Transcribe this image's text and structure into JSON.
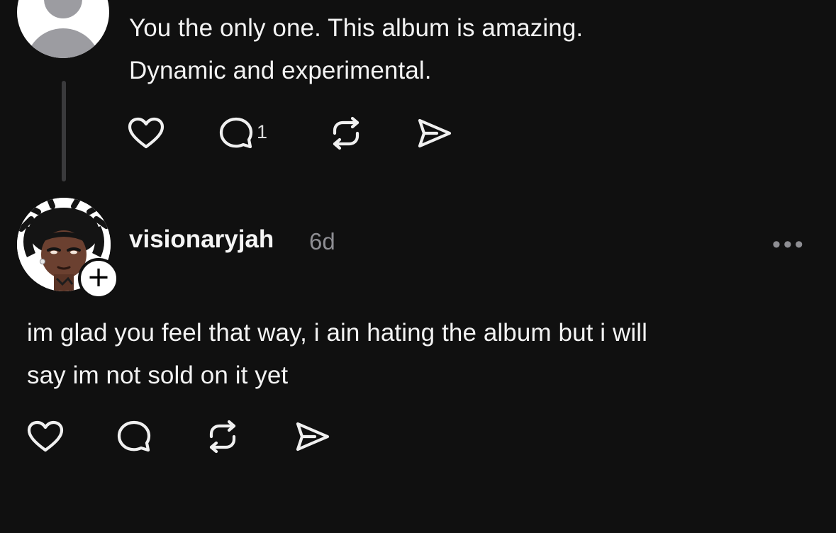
{
  "post1": {
    "text_line1": "You the only one. This album is amazing.",
    "text_line2": "Dynamic and experimental.",
    "reply_count": "1"
  },
  "post2": {
    "username": "visionaryjah",
    "time": "6d",
    "text_line1": "im glad you feel that way, i ain hating the album but i will",
    "text_line2": "say im not sold on it yet"
  },
  "icons": {
    "like": "heart-icon",
    "reply": "comment-icon",
    "repost": "repost-icon",
    "share": "send-icon",
    "more": "more-icon",
    "follow": "plus-icon"
  },
  "colors": {
    "background": "#101010",
    "text": "#f3f3f3",
    "muted": "#8e8e93",
    "thread_line": "#3a3a3c"
  }
}
